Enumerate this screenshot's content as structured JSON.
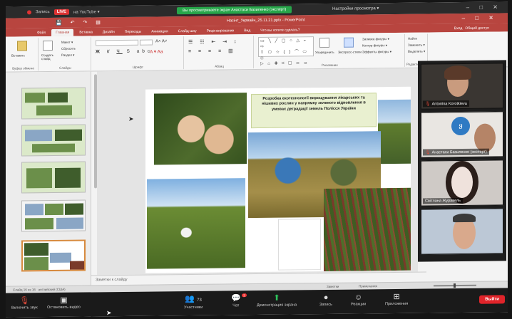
{
  "zoom_top": {
    "rec_label": "Запись",
    "live_label": "LIVE",
    "youtube_label": "на YouTube ▾",
    "share_banner": "Вы просматриваете экран Анастаси Базиленко (эксперт)",
    "view_options": "Настройки просмотра ▾"
  },
  "ppt": {
    "window_title": "Насінт_Укрвайн_25.11.21.pptx - PowerPoint",
    "sign_in": "Вход",
    "share": "Общий доступ",
    "tabs": [
      "Файл",
      "Главная",
      "Вставка",
      "Дизайн",
      "Переходы",
      "Анимация",
      "Слайд-шоу",
      "Рецензирование",
      "Вид",
      "Что вы хотите сделать?"
    ],
    "active_tab": "Главная",
    "groups": {
      "clipboard": "Буфер обмена",
      "slides": "Слайды",
      "font": "Шрифт",
      "paragraph": "Абзац",
      "drawing": "Рисование",
      "editing": "Редактирование"
    },
    "buttons": {
      "paste": "Вставить",
      "new_slide": "Создать слайд",
      "layout": "Макет ▾",
      "reset": "Сбросить",
      "section": "Раздел ▾",
      "arrange": "Упорядочить",
      "quick_styles": "Экспресс-стили",
      "shape_fill": "Заливка фигуры ▾",
      "shape_outline": "Контур фигуры ▾",
      "shape_effects": "Эффекты фигуры ▾",
      "find": "Найти",
      "replace": "Заменить ▾",
      "select": "Выделить ▾"
    }
  },
  "slide": {
    "title": "Розробка екотехнології вирощування лікарських та нішевих рослин у напрямку зеленого відновлення в умовах деградації земель Полісся України"
  },
  "thumbnails": [
    {
      "num": "12"
    },
    {
      "num": "13"
    },
    {
      "num": "14"
    },
    {
      "num": "15"
    },
    {
      "num": "16"
    }
  ],
  "notes": {
    "placeholder": "Заметки к слайду"
  },
  "status": {
    "slide_info": "Слайд 16 из 16",
    "language": "английский (США)",
    "notes_btn": "Заметки",
    "comments_btn": "Примечания"
  },
  "participants": [
    {
      "name": "Antonina Korotkieva",
      "muted": true
    },
    {
      "name": "Анастаси Базиленко (эксперт)",
      "muted": true,
      "logo": "yu"
    },
    {
      "name": "Світлана Журавель",
      "muted": false
    },
    {
      "name": "",
      "muted": false
    }
  ],
  "zoom_bottom": {
    "audio": "Включить звук",
    "video": "Остановить видео",
    "participants": "Участники",
    "participants_count": "73",
    "chat": "Чат",
    "chat_badge": "2",
    "share": "Демонстрация экрана",
    "record": "Запись",
    "reactions": "Реакции",
    "apps": "Приложения",
    "leave": "Выйти"
  },
  "colors": {
    "ppt_accent": "#b8453f",
    "zoom_bg": "#1a1a1a",
    "share_green": "#27a64a",
    "leave_red": "#e0242a"
  }
}
